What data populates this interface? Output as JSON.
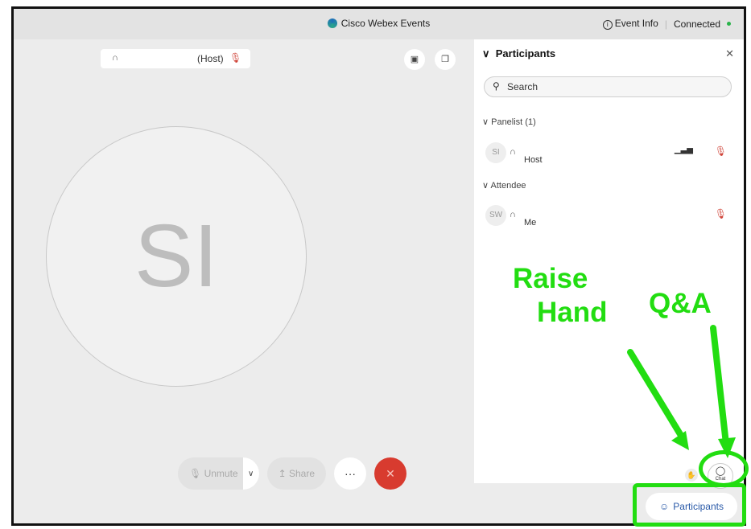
{
  "window": {
    "title": "Cisco Webex Events",
    "event_info": "Event Info",
    "status": "Connected"
  },
  "stage": {
    "host_chip": {
      "role": "(Host)"
    },
    "avatar_initials": "SI"
  },
  "controls": {
    "unmute": "Unmute",
    "share": "Share",
    "more": "···",
    "end": "✕"
  },
  "panel": {
    "title": "Participants",
    "search_placeholder": "Search",
    "panelist_group": "Panelist (1)",
    "attendee_group": "Attendee",
    "panelists": [
      {
        "initials": "SI",
        "label": "Host"
      }
    ],
    "attendees": [
      {
        "initials": "SW",
        "label": "Me"
      }
    ],
    "chat_label": "Chat"
  },
  "footer": {
    "participants_button": "Participants"
  },
  "annotations": {
    "raise_hand": [
      "Raise",
      "Hand"
    ],
    "qa": "Q&A"
  },
  "colors": {
    "annotation": "#22dd11",
    "end_call": "#d83b2f",
    "link": "#2a5aa8"
  }
}
